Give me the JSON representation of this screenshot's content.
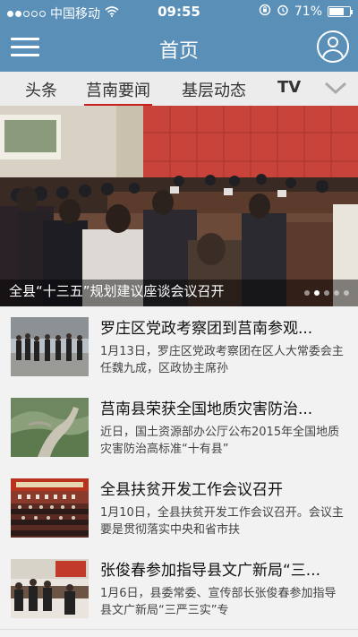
{
  "status": {
    "carrier": "中国移动",
    "time": "09:55",
    "battery": "71%",
    "battery_level": 0.71
  },
  "header": {
    "title": "首页"
  },
  "tabs": [
    {
      "label": "头条",
      "active": false
    },
    {
      "label": "莒南要闻",
      "active": true
    },
    {
      "label": "基层动态",
      "active": false
    },
    {
      "label": "TV",
      "active": false
    }
  ],
  "banner": {
    "caption": "全县“十三五”规划建议座谈会议召开",
    "slides": 5,
    "current": 1
  },
  "news": [
    {
      "title": "罗庄区党政考察团到莒南参观...",
      "summary": "1月13日，罗庄区党政考察团在区人大常委会主任魏九成，区政协主席孙",
      "thumb": "meeting-outdoor"
    },
    {
      "title": "莒南县荣获全国地质灾害防治...",
      "summary": "近日，国土资源部办公厅公布2015年全国地质灾害防治高标准“十有县”",
      "thumb": "hillside"
    },
    {
      "title": "全县扶贫开发工作会议召开",
      "summary": "1月10日，全县扶贫开发工作会议召开。会议主要是贯彻落实中央和省市扶",
      "thumb": "auditorium"
    },
    {
      "title": "张俊春参加指导县文广新局“三...",
      "summary": "1月6日，县委常委、宣传部长张俊春参加指导县文广新局“三严三实”专",
      "thumb": "meeting-room"
    }
  ]
}
